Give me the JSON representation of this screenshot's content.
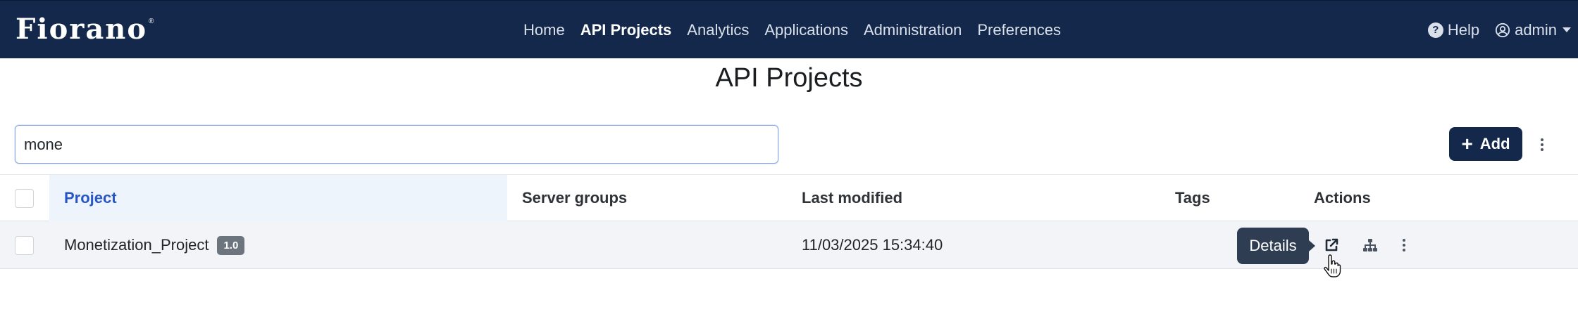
{
  "brand": {
    "logo_text": "Fiorano",
    "registered": "®"
  },
  "nav": {
    "links": [
      {
        "label": "Home"
      },
      {
        "label": "API Projects"
      },
      {
        "label": "Analytics"
      },
      {
        "label": "Applications"
      },
      {
        "label": "Administration"
      },
      {
        "label": "Preferences"
      }
    ],
    "help_label": "Help",
    "user_label": "admin"
  },
  "page": {
    "title": "API Projects"
  },
  "search": {
    "value": "mone"
  },
  "toolbar": {
    "add_label": "Add"
  },
  "table": {
    "columns": {
      "project": "Project",
      "server_groups": "Server groups",
      "last_modified": "Last modified",
      "tags": "Tags",
      "actions": "Actions"
    },
    "rows": [
      {
        "project": "Monetization_Project",
        "version": "1.0",
        "server_groups": "",
        "last_modified": "11/03/2025 15:34:40",
        "tags": ""
      }
    ]
  },
  "tooltip": {
    "text": "Details"
  },
  "icons": {
    "help": "question-circle-icon",
    "user": "user-circle-icon",
    "details": "external-link-icon",
    "hierarchy": "sitemap-icon",
    "more": "kebab-menu-icon",
    "cursor": "hand-pointer-icon"
  },
  "colors": {
    "navbar": "#13284b",
    "accent": "#2856c8",
    "badge": "#6c757d",
    "tooltip": "#2f3d52"
  }
}
